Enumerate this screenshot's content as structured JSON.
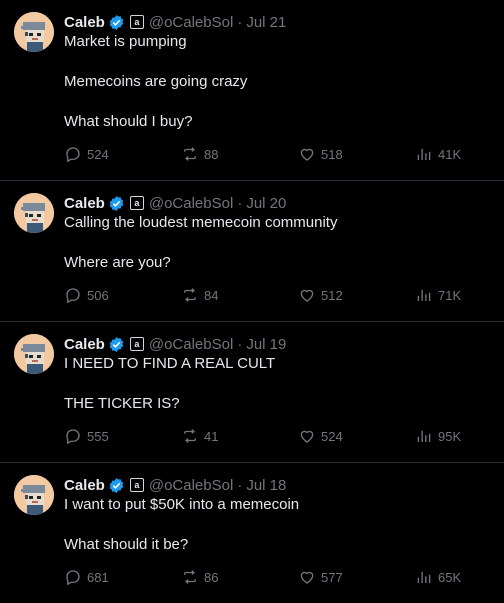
{
  "tweets": [
    {
      "name": "Caleb",
      "handle": "@oCalebSol",
      "date": "Jul 21",
      "lines": [
        "Market is pumping",
        "",
        "Memecoins are going crazy",
        "",
        "What should I buy?"
      ],
      "replies": "524",
      "retweets": "88",
      "likes": "518",
      "views": "41K"
    },
    {
      "name": "Caleb",
      "handle": "@oCalebSol",
      "date": "Jul 20",
      "lines": [
        "Calling the loudest memecoin community",
        "",
        "Where are you?"
      ],
      "replies": "506",
      "retweets": "84",
      "likes": "512",
      "views": "71K"
    },
    {
      "name": "Caleb",
      "handle": "@oCalebSol",
      "date": "Jul 19",
      "lines": [
        "I NEED TO FIND A REAL CULT",
        "",
        "THE TICKER IS?"
      ],
      "replies": "555",
      "retweets": "41",
      "likes": "524",
      "views": "95K"
    },
    {
      "name": "Caleb",
      "handle": "@oCalebSol",
      "date": "Jul 18",
      "lines": [
        "I want to put $50K into a memecoin",
        "",
        "What should it be?"
      ],
      "replies": "681",
      "retweets": "86",
      "likes": "577",
      "views": "65K"
    }
  ],
  "separator": "·",
  "affiliate_badge": "a",
  "colors": {
    "background": "#000000",
    "text": "#e7e9ea",
    "muted": "#71767b",
    "verified": "#1d9bf0",
    "border": "#2f3336"
  }
}
